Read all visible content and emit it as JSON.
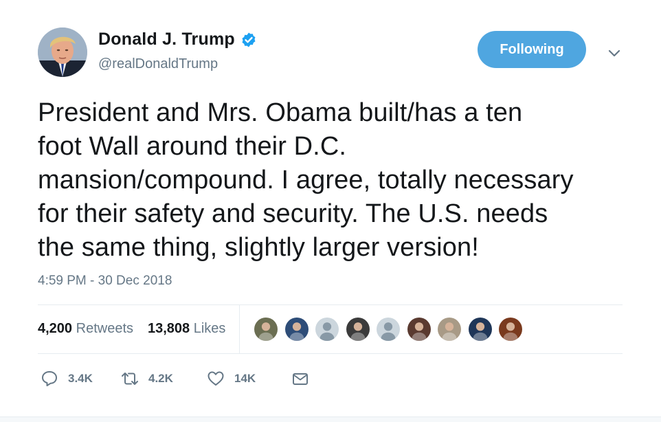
{
  "colors": {
    "accent": "#1da1f2",
    "follow_button": "#4fa6e0",
    "muted_text": "#657786",
    "text": "#14171a",
    "divider": "#e6ecf0"
  },
  "author": {
    "display_name": "Donald J. Trump",
    "handle": "@realDonaldTrump",
    "verified_icon": "verified-badge-icon",
    "avatar_icon": "profile-photo"
  },
  "follow_button": {
    "label": "Following"
  },
  "menu": {
    "icon": "chevron-down-icon"
  },
  "tweet": {
    "text": "President and Mrs. Obama built/has a ten\nfoot Wall around their D.C.\nmansion/compound. I agree, totally necessary\nfor their safety and security. The U.S. needs\nthe same thing, slightly larger version!",
    "timestamp": "4:59 PM - 30 Dec 2018"
  },
  "stats": {
    "retweets_count": "4,200",
    "retweets_label": "Retweets",
    "likes_count": "13,808",
    "likes_label": "Likes"
  },
  "likers": [
    {
      "icon": "user-avatar-photo",
      "bg": "#6b6e52"
    },
    {
      "icon": "user-avatar-photo",
      "bg": "#2e4d78"
    },
    {
      "icon": "default-avatar-icon",
      "bg": "#ccd6dd"
    },
    {
      "icon": "user-avatar-photo",
      "bg": "#3b3b3b"
    },
    {
      "icon": "default-avatar-icon",
      "bg": "#ccd6dd"
    },
    {
      "icon": "user-avatar-photo",
      "bg": "#5a3a30"
    },
    {
      "icon": "user-avatar-photo",
      "bg": "#a89a86"
    },
    {
      "icon": "user-avatar-photo",
      "bg": "#1f3658"
    },
    {
      "icon": "user-avatar-photo",
      "bg": "#7a3a1e"
    }
  ],
  "actions": {
    "reply": {
      "icon": "reply-icon",
      "count": "3.4K"
    },
    "retweet": {
      "icon": "retweet-icon",
      "count": "4.2K"
    },
    "like": {
      "icon": "heart-icon",
      "count": "14K"
    },
    "dm": {
      "icon": "envelope-icon"
    }
  }
}
